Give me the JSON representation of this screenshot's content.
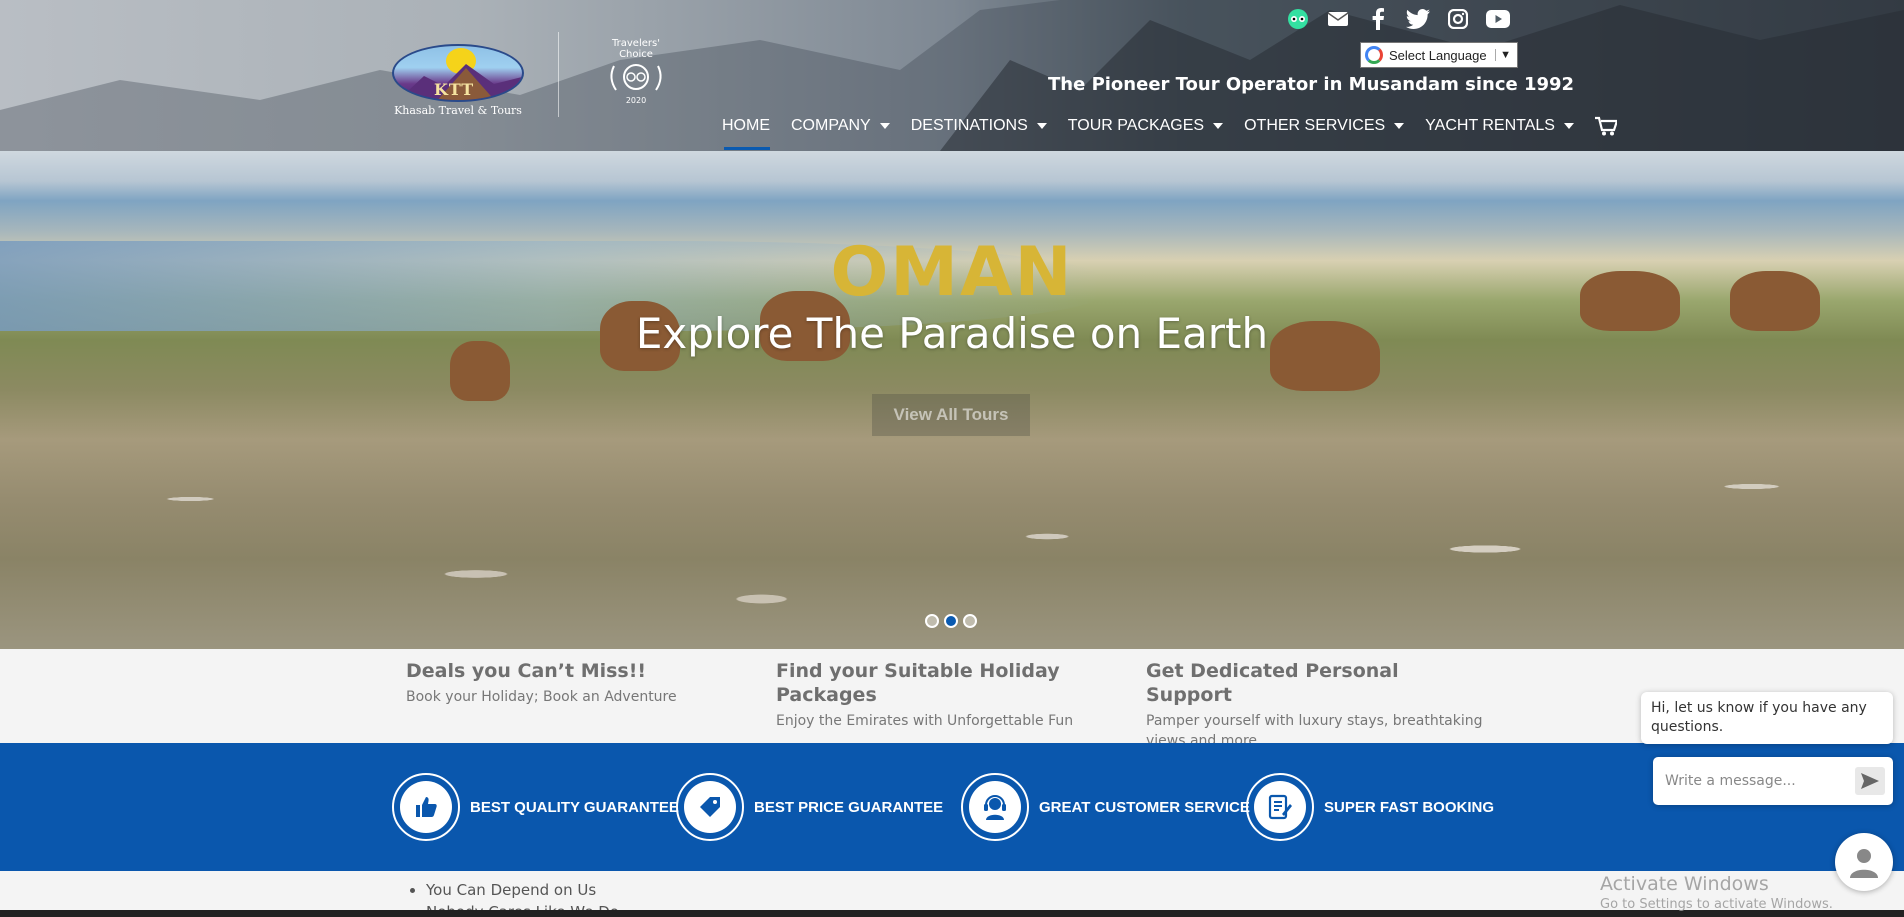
{
  "header": {
    "logo_text": "Khasab Travel & Tours",
    "logo_abbr": "KTT",
    "award_title_1": "Travelers'",
    "award_title_2": "Choice",
    "award_year": "2020",
    "tagline": "The Pioneer Tour Operator in Musandam since 1992",
    "language_select": "Select Language",
    "social_icons": [
      "tripadvisor-icon",
      "email-icon",
      "facebook-icon",
      "twitter-icon",
      "instagram-icon",
      "youtube-icon"
    ],
    "nav": [
      {
        "label": "HOME",
        "active": true
      },
      {
        "label": "COMPANY"
      },
      {
        "label": "DESTINATIONS"
      },
      {
        "label": "TOUR PACKAGES"
      },
      {
        "label": "OTHER SERVICES"
      },
      {
        "label": "YACHT RENTALS"
      }
    ]
  },
  "hero": {
    "title": "OMAN",
    "subtitle": "Explore The Paradise on Earth",
    "button": "View All Tours",
    "active_slide": 2,
    "slide_count": 3
  },
  "features": [
    {
      "title": "Deals you Can’t Miss!!",
      "text": "Book your Holiday; Book an Adventure"
    },
    {
      "title": "Find your Suitable Holiday Packages",
      "text": "Enjoy the Emirates with Unforgettable Fun"
    },
    {
      "title": "Get Dedicated Personal Support",
      "text": "Pamper yourself with luxury stays, breathtaking views and more"
    }
  ],
  "band": [
    {
      "label": "BEST QUALITY GUARANTEE",
      "icon": "thumbs-up-icon"
    },
    {
      "label": "BEST PRICE GUARANTEE",
      "icon": "price-tag-icon"
    },
    {
      "label": "GREAT CUSTOMER SERVICE",
      "icon": "headset-icon"
    },
    {
      "label": "SUPER FAST BOOKING",
      "icon": "booking-form-icon"
    }
  ],
  "bottom_list": [
    "You Can Depend on Us",
    "Nobody Cares Like We Do"
  ],
  "chat": {
    "greeting": "Hi, let us know if you have any questions.",
    "placeholder": "Write a message..."
  },
  "watermark": {
    "line1": "Activate Windows",
    "line2": "Go to Settings to activate Windows."
  },
  "colors": {
    "brand_blue": "#0a57ad",
    "hero_title_gold": "#d7b536"
  }
}
